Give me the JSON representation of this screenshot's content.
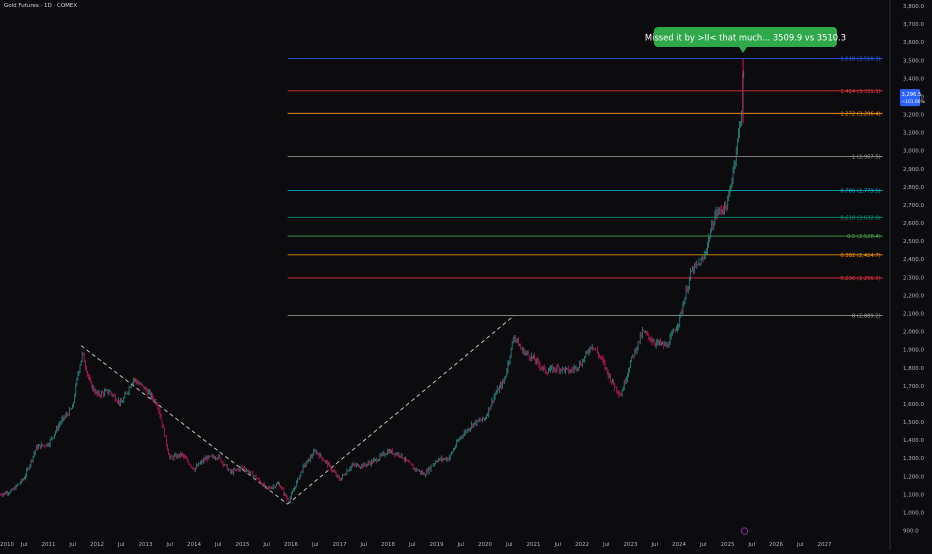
{
  "header": {
    "ticker": "Gold Futures · 1D · COMEX"
  },
  "annotation": {
    "text": "Missed it by >II< that much... 3509.9 vs 3510.3"
  },
  "price_tag": {
    "price": "3,296.5",
    "change": "−101.66%"
  },
  "colors": {
    "background": "#0c0c0e",
    "candle_up": "#2a8c86",
    "candle_down": "#c2185b",
    "trend": "#bfbfbf",
    "callout": "#2fa84a",
    "price_tag": "#2962ff"
  },
  "chart_data": {
    "type": "line",
    "title": "",
    "xlabel": "",
    "ylabel": "",
    "x_tick_labels": [
      "2010",
      "Jul",
      "2011",
      "Jul",
      "2012",
      "Jul",
      "2013",
      "Jul",
      "2014",
      "Jul",
      "2015",
      "Jul",
      "2016",
      "Jul",
      "2017",
      "Jul",
      "2018",
      "Jul",
      "2019",
      "Jul",
      "2020",
      "Jul",
      "2021",
      "Jul",
      "2022",
      "Jul",
      "2023",
      "Jul",
      "2024",
      "Jul",
      "2025",
      "Jul",
      "2026",
      "Jul",
      "2027"
    ],
    "y_ticks": [
      900,
      1000,
      1100,
      1200,
      1300,
      1400,
      1500,
      1600,
      1700,
      1800,
      1900,
      2000,
      2100,
      2200,
      2300,
      2400,
      2500,
      2600,
      2700,
      2800,
      2900,
      3000,
      3100,
      3200,
      3300,
      3400,
      3500,
      3600,
      3700,
      3800
    ],
    "ylim": [
      870,
      3800
    ],
    "xlim": [
      2010.0,
      2028.35
    ],
    "price_series": {
      "x": [
        2010.0,
        2010.25,
        2010.5,
        2010.75,
        2011.0,
        2011.25,
        2011.5,
        2011.6,
        2011.7,
        2011.85,
        2012.0,
        2012.25,
        2012.5,
        2012.75,
        2013.0,
        2013.25,
        2013.5,
        2013.75,
        2014.0,
        2014.25,
        2014.5,
        2014.75,
        2015.0,
        2015.25,
        2015.5,
        2015.75,
        2015.95,
        2016.25,
        2016.5,
        2016.75,
        2017.0,
        2017.25,
        2017.5,
        2017.75,
        2018.0,
        2018.25,
        2018.5,
        2018.75,
        2019.0,
        2019.25,
        2019.5,
        2019.75,
        2020.0,
        2020.2,
        2020.4,
        2020.6,
        2020.75,
        2021.0,
        2021.25,
        2021.5,
        2021.75,
        2022.0,
        2022.2,
        2022.4,
        2022.6,
        2022.8,
        2023.0,
        2023.25,
        2023.5,
        2023.75,
        2024.0,
        2024.25,
        2024.5,
        2024.75,
        2025.0,
        2025.15,
        2025.3,
        2025.32,
        2025.35
      ],
      "y": [
        1100,
        1120,
        1190,
        1360,
        1380,
        1500,
        1580,
        1760,
        1880,
        1720,
        1650,
        1670,
        1600,
        1740,
        1680,
        1600,
        1300,
        1320,
        1240,
        1300,
        1310,
        1220,
        1250,
        1200,
        1130,
        1160,
        1060,
        1250,
        1340,
        1270,
        1180,
        1260,
        1260,
        1290,
        1340,
        1320,
        1250,
        1210,
        1290,
        1300,
        1420,
        1490,
        1520,
        1650,
        1730,
        1980,
        1900,
        1850,
        1780,
        1800,
        1780,
        1830,
        1930,
        1850,
        1730,
        1650,
        1830,
        2000,
        1940,
        1920,
        2060,
        2330,
        2400,
        2650,
        2700,
        2950,
        3240,
        3509.9,
        3296.5
      ]
    },
    "trend_lines": [
      {
        "x": [
          2011.67,
          2015.93
        ],
        "y": [
          1923,
          1046
        ]
      },
      {
        "x": [
          2015.93,
          2020.6
        ],
        "y": [
          1046,
          2089
        ]
      }
    ],
    "fib_levels": [
      {
        "ratio": "0",
        "value": 2089.2,
        "label": "0 (2,089.2)",
        "color": "#9e9e9e"
      },
      {
        "ratio": "0.236",
        "value": 2296.5,
        "label": "0.236 (2,296.5)",
        "color": "#f23645"
      },
      {
        "ratio": "0.382",
        "value": 2424.7,
        "label": "0.382 (2,424.7)",
        "color": "#ff9800"
      },
      {
        "ratio": "0.5",
        "value": 2528.4,
        "label": "0.5 (2,528.4)",
        "color": "#4caf50"
      },
      {
        "ratio": "0.618",
        "value": 2632.0,
        "label": "0.618 (2,632.0)",
        "color": "#089981"
      },
      {
        "ratio": "0.786",
        "value": 2779.5,
        "label": "0.786 (2,779.5)",
        "color": "#00bcd4"
      },
      {
        "ratio": "1",
        "value": 2967.5,
        "label": "1 (2,967.5)",
        "color": "#9e9e9e"
      },
      {
        "ratio": "1.272",
        "value": 3206.4,
        "label": "1.272 (3,206.4)",
        "color": "#ff9800"
      },
      {
        "ratio": "1.414",
        "value": 3331.1,
        "label": "1.414 (3,331.1)",
        "color": "#f23645"
      },
      {
        "ratio": "1.618",
        "value": 3510.3,
        "label": "1.618 (3,510.3)",
        "color": "#2962ff"
      }
    ],
    "grid": false,
    "legend": "none"
  }
}
